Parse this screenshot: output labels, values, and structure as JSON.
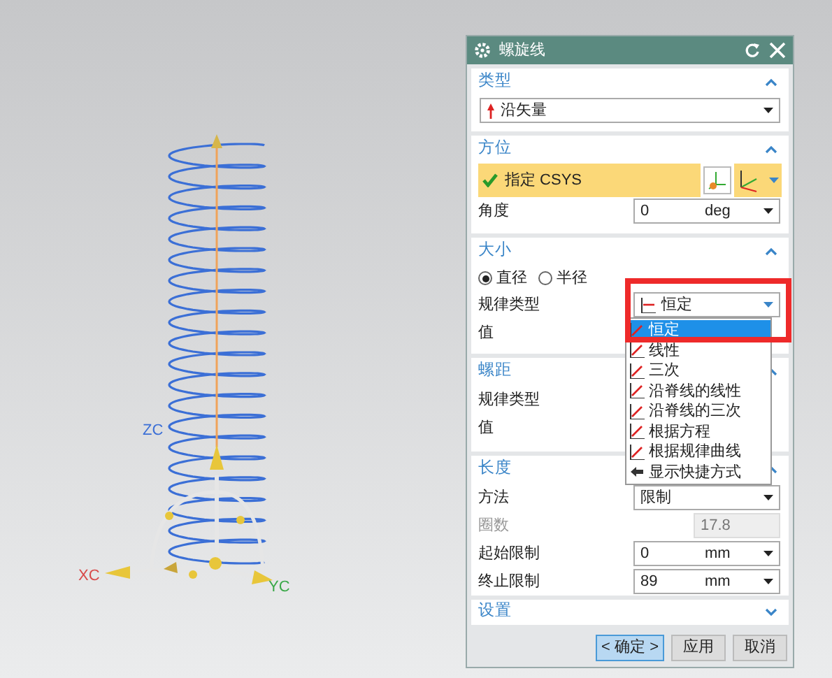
{
  "viewport": {
    "axis_labels": [
      {
        "kind": "z",
        "text": "ZC"
      },
      {
        "kind": "x",
        "text": "XC"
      },
      {
        "kind": "y",
        "text": "YC"
      }
    ]
  },
  "dialog": {
    "title": "螺旋线",
    "sections": [
      {
        "title": "类型",
        "expanded": true,
        "rows": [
          {
            "kind": "select",
            "value": "沿矢量"
          }
        ]
      },
      {
        "title": "方位",
        "expanded": true,
        "rows": [
          {
            "kind": "csys",
            "label": "指定 CSYS",
            "checked": true
          },
          {
            "kind": "field",
            "label": "角度",
            "value": "0",
            "unit": "deg"
          }
        ]
      },
      {
        "title": "大小",
        "expanded": true,
        "rows": [
          {
            "kind": "radio",
            "options": [
              {
                "label": "直径",
                "selected": true
              },
              {
                "label": "半径",
                "selected": false
              }
            ]
          },
          {
            "kind": "select",
            "label": "规律类型",
            "value": "恒定",
            "open": true,
            "highlighted": true
          },
          {
            "kind": "label",
            "label": "值"
          }
        ]
      },
      {
        "title": "螺距",
        "expanded": true,
        "rows": [
          {
            "kind": "label",
            "label": "规律类型"
          },
          {
            "kind": "label",
            "label": "值"
          }
        ]
      },
      {
        "title": "长度",
        "expanded": true,
        "rows": [
          {
            "kind": "select",
            "label": "方法",
            "value": "限制"
          },
          {
            "kind": "field",
            "label": "圈数",
            "value": "17.8",
            "disabled": true
          },
          {
            "kind": "field",
            "label": "起始限制",
            "value": "0",
            "unit": "mm"
          },
          {
            "kind": "field",
            "label": "终止限制",
            "value": "89",
            "unit": "mm"
          }
        ]
      },
      {
        "title": "设置",
        "expanded": false
      }
    ],
    "dropdown_items": [
      {
        "kind": "law",
        "label": "恒定",
        "selected": true
      },
      {
        "kind": "law",
        "label": "线性",
        "selected": false
      },
      {
        "kind": "law",
        "label": "三次",
        "selected": false
      },
      {
        "kind": "law",
        "label": "沿脊线的线性",
        "selected": false
      },
      {
        "kind": "law",
        "label": "沿脊线的三次",
        "selected": false
      },
      {
        "kind": "law",
        "label": "根据方程",
        "selected": false
      },
      {
        "kind": "law",
        "label": "根据规律曲线",
        "selected": false
      },
      {
        "kind": "command",
        "label": "显示快捷方式",
        "selected": false
      }
    ],
    "buttons": [
      {
        "kind": "primary",
        "label": "< 确定 >"
      },
      {
        "kind": "normal",
        "label": "应用"
      },
      {
        "kind": "normal",
        "label": "取消"
      }
    ]
  }
}
